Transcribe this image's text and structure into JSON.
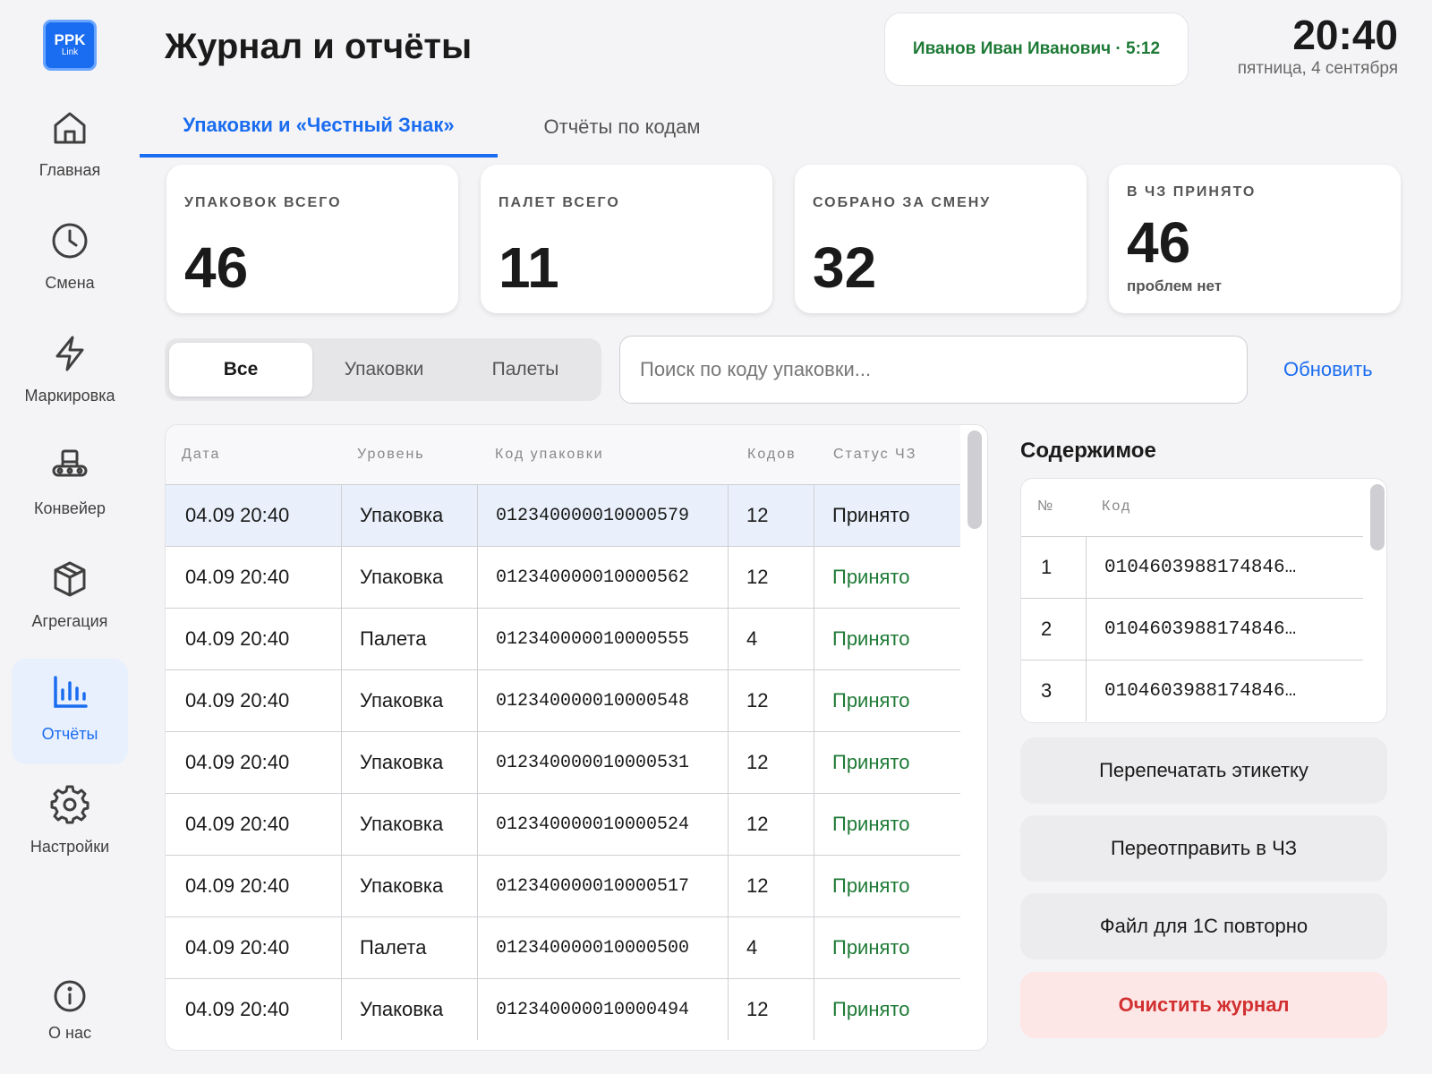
{
  "logo": {
    "line1": "PPK",
    "line2": "Link"
  },
  "sidebar": {
    "items": [
      {
        "label": "Главная",
        "icon": "home-icon"
      },
      {
        "label": "Смена",
        "icon": "clock-icon"
      },
      {
        "label": "Маркировка",
        "icon": "lightning-icon"
      },
      {
        "label": "Конвейер",
        "icon": "conveyor-icon"
      },
      {
        "label": "Агрегация",
        "icon": "box-icon"
      },
      {
        "label": "Отчёты",
        "icon": "bar-chart-icon",
        "active": true
      },
      {
        "label": "Настройки",
        "icon": "gear-icon"
      }
    ],
    "about": {
      "label": "О нас",
      "icon": "info-icon"
    }
  },
  "header": {
    "title": "Журнал и отчёты",
    "user": "Иванов Иван Иванович · 5:12",
    "time": "20:40",
    "date": "пятница, 4 сентября"
  },
  "tabs": [
    {
      "label": "Упаковки и «Честный Знак»",
      "active": true
    },
    {
      "label": "Отчёты по кодам",
      "active": false
    }
  ],
  "stats": [
    {
      "label": "УПАКОВОК ВСЕГО",
      "value": "46"
    },
    {
      "label": "ПАЛЕТ ВСЕГО",
      "value": "11"
    },
    {
      "label": "СОБРАНО ЗА СМЕНУ",
      "value": "32"
    },
    {
      "label": "В ЧЗ ПРИНЯТО",
      "value": "46",
      "sub": "проблем нет"
    }
  ],
  "filters": {
    "segments": [
      "Все",
      "Упаковки",
      "Палеты"
    ],
    "active_segment": "Все",
    "search_placeholder": "Поиск по коду упаковки...",
    "search_value": "",
    "refresh_label": "Обновить"
  },
  "journal": {
    "columns": [
      "Дата",
      "Уровень",
      "Код упаковки",
      "Кодов",
      "Статус ЧЗ"
    ],
    "rows": [
      {
        "date": "04.09 20:40",
        "level": "Упаковка",
        "code": "012340000010000579",
        "count": "12",
        "status": "Принято",
        "selected": true
      },
      {
        "date": "04.09 20:40",
        "level": "Упаковка",
        "code": "012340000010000562",
        "count": "12",
        "status": "Принято"
      },
      {
        "date": "04.09 20:40",
        "level": "Палета",
        "code": "012340000010000555",
        "count": "4",
        "status": "Принято"
      },
      {
        "date": "04.09 20:40",
        "level": "Упаковка",
        "code": "012340000010000548",
        "count": "12",
        "status": "Принято"
      },
      {
        "date": "04.09 20:40",
        "level": "Упаковка",
        "code": "012340000010000531",
        "count": "12",
        "status": "Принято"
      },
      {
        "date": "04.09 20:40",
        "level": "Упаковка",
        "code": "012340000010000524",
        "count": "12",
        "status": "Принято"
      },
      {
        "date": "04.09 20:40",
        "level": "Упаковка",
        "code": "012340000010000517",
        "count": "12",
        "status": "Принято"
      },
      {
        "date": "04.09 20:40",
        "level": "Палета",
        "code": "012340000010000500",
        "count": "4",
        "status": "Принято"
      },
      {
        "date": "04.09 20:40",
        "level": "Упаковка",
        "code": "012340000010000494",
        "count": "12",
        "status": "Принято"
      }
    ]
  },
  "contents": {
    "title": "Содержимое",
    "columns": [
      "№",
      "Код"
    ],
    "rows": [
      {
        "n": "1",
        "code": "0104603988174846…"
      },
      {
        "n": "2",
        "code": "0104603988174846…"
      },
      {
        "n": "3",
        "code": "0104603988174846…"
      }
    ]
  },
  "actions": {
    "reprint": "Перепечатать этикетку",
    "resend": "Переотправить в ЧЗ",
    "file1c": "Файл для 1С повторно",
    "clear": "Очистить журнал"
  },
  "colors": {
    "accent": "#1a6cf0",
    "status_ok": "#1e7a36",
    "danger": "#d23030"
  }
}
